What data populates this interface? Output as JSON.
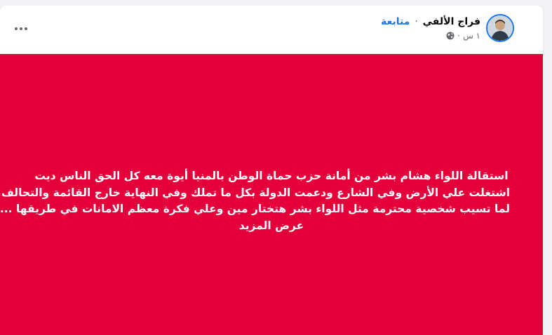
{
  "post": {
    "author": "فراج الألفي",
    "separator": "·",
    "follow_label": "متابعة",
    "time": "١ س",
    "time_separator": "·",
    "privacy_icon": "globe-icon",
    "more_icon": "more-dots-icon",
    "background_color": "#e4003a",
    "text_lines": [
      "استقالة اللواء هشام بشر من أمانة حزب حماة الوطن بالمنيا أيوة معه كل الحق الناس ديت",
      "اشتغلت علي الأرض وفي الشارع ودعمت الدولة بكل ما تملك وفي النهاية خارج القائمة والتحالف",
      "لما تسيب شخصية محترمة مثل اللواء بشر هتختار مين وعلي فكرة معظم الامانات في طريقها ..."
    ],
    "see_more_label": "عرض المزيد"
  }
}
